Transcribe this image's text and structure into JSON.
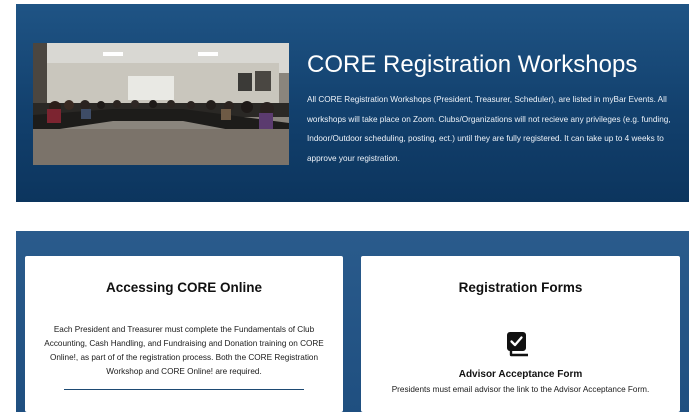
{
  "hero": {
    "title": "CORE Registration Workshops",
    "description": "All CORE Registration Workshops (President, Treasurer, Scheduler), are listed in myBar Events. All workshops will take place on Zoom. Clubs/Organizations will not recieve any privileges (e.g. funding, Indoor/Outdoor scheduling, posting, ect.) until they are fully registered. It can take up to 4 weeks to approve your registration."
  },
  "accessing": {
    "title": "Accessing CORE Online",
    "body": "Each President and Treasurer must complete the Fundamentals of Club Accounting, Cash Handling, and Fundraising and Donation training on CORE Online!, as part of of the registration process. Both the CORE Registration Workshop and CORE Online! are required."
  },
  "forms": {
    "title": "Registration Forms",
    "icon": "checkbox-stack-icon",
    "item_title": "Advisor Acceptance Form",
    "item_desc": "Presidents must email advisor the link to the Advisor Acceptance Form."
  }
}
